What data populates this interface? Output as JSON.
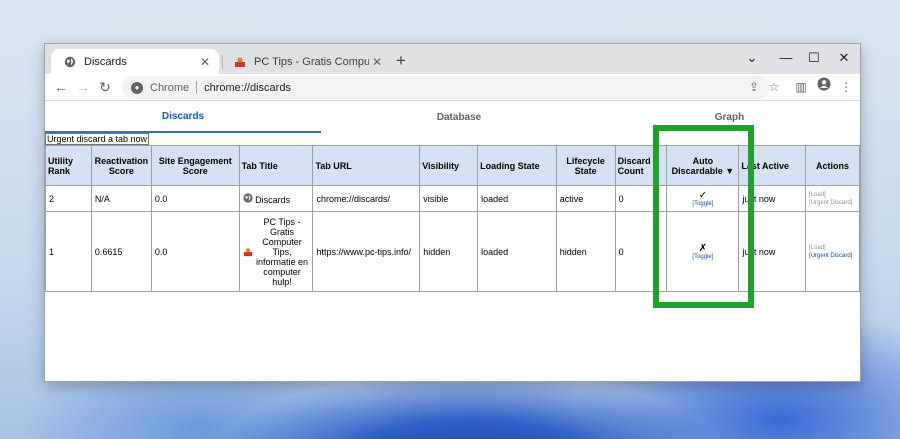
{
  "browser": {
    "tabs": [
      {
        "title": "Discards",
        "icon": "globe-icon"
      },
      {
        "title": "PC Tips - Gratis Computer Tips, i",
        "icon": "pctips-favicon-icon"
      }
    ],
    "window_controls": {
      "minimize": "—",
      "maximize": "☐",
      "close": "✕",
      "tabsearch": "⌄"
    },
    "omnibox": {
      "chip": "Chrome",
      "url": "chrome://discards"
    }
  },
  "page": {
    "nav_tabs": [
      "Discards",
      "Database",
      "Graph"
    ],
    "urgent_button": "Urgent discard a tab now",
    "columns": [
      "Utility Rank",
      "Reactivation Score",
      "Site Engagement Score",
      "Tab Title",
      "Tab URL",
      "Visibility",
      "Loading State",
      "Lifecycle State",
      "Discard Count",
      "Auto Discardable",
      "Last Active",
      "Actions"
    ],
    "sort_indicator": "▼",
    "rows": [
      {
        "utility_rank": "2",
        "reactivation_score": "N/A",
        "site_engagement_score": "0.0",
        "tab_title": "Discards",
        "tab_url": "chrome://discards/",
        "visibility": "visible",
        "loading_state": "loaded",
        "lifecycle_state": "active",
        "discard_count": "0",
        "auto_discardable_mark": "✓",
        "toggle_label": "[Toggle]",
        "last_active": "just now",
        "action_load": "[Load]",
        "action_urgent": "[Urgent Discard]"
      },
      {
        "utility_rank": "1",
        "reactivation_score": "0.6615",
        "site_engagement_score": "0.0",
        "tab_title": "PC Tips - Gratis Computer Tips, informatie en computer hulp!",
        "tab_url": "https://www.pc-tips.info/",
        "visibility": "hidden",
        "loading_state": "loaded",
        "lifecycle_state": "hidden",
        "discard_count": "0",
        "auto_discardable_mark": "✗",
        "toggle_label": "[Toggle]",
        "last_active": "just now",
        "action_load": "[Load]",
        "action_urgent": "[Urgent Discard]"
      }
    ]
  },
  "colors": {
    "header_bg": "#d6e2f3",
    "selected_tab": "#1a57b8",
    "highlight_box": "#1fa22d"
  }
}
